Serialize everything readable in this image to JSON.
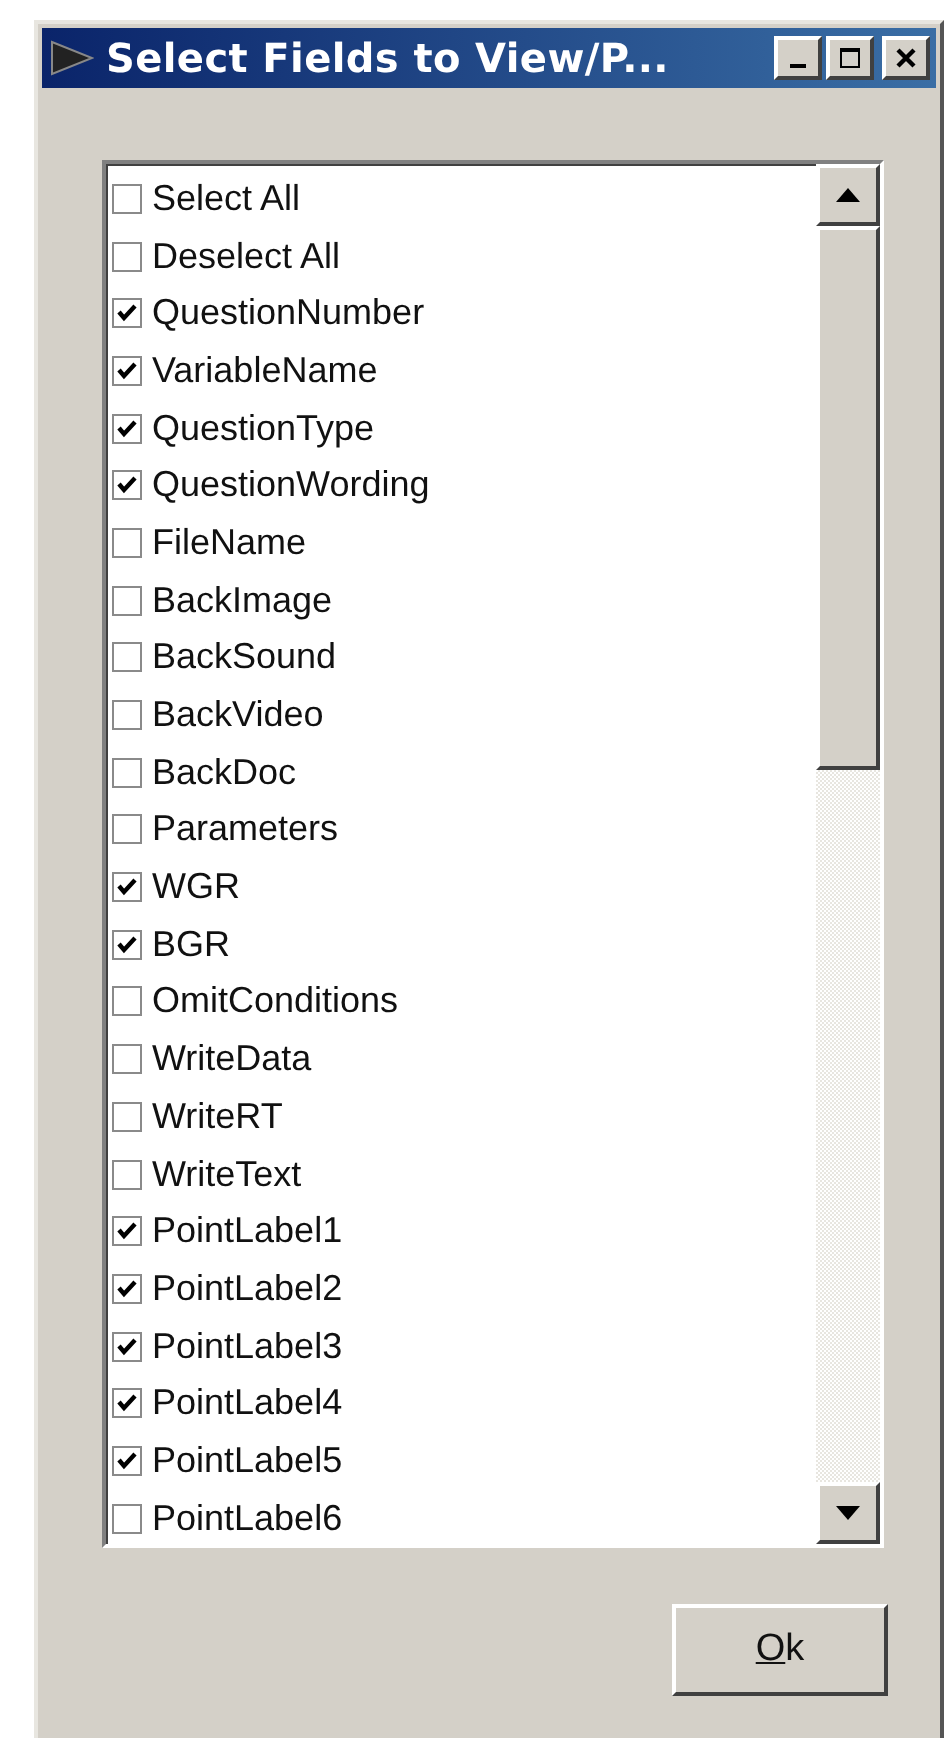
{
  "window": {
    "title": "Select Fields to View/P..."
  },
  "fields": [
    {
      "label": "Select All",
      "checked": false
    },
    {
      "label": "Deselect All",
      "checked": false
    },
    {
      "label": "QuestionNumber",
      "checked": true
    },
    {
      "label": "VariableName",
      "checked": true
    },
    {
      "label": "QuestionType",
      "checked": true
    },
    {
      "label": "QuestionWording",
      "checked": true
    },
    {
      "label": "FileName",
      "checked": false
    },
    {
      "label": "BackImage",
      "checked": false
    },
    {
      "label": "BackSound",
      "checked": false
    },
    {
      "label": "BackVideo",
      "checked": false
    },
    {
      "label": "BackDoc",
      "checked": false
    },
    {
      "label": "Parameters",
      "checked": false
    },
    {
      "label": "WGR",
      "checked": true
    },
    {
      "label": "BGR",
      "checked": true
    },
    {
      "label": "OmitConditions",
      "checked": false
    },
    {
      "label": "WriteData",
      "checked": false
    },
    {
      "label": "WriteRT",
      "checked": false
    },
    {
      "label": "WriteText",
      "checked": false
    },
    {
      "label": "PointLabel1",
      "checked": true
    },
    {
      "label": "PointLabel2",
      "checked": true
    },
    {
      "label": "PointLabel3",
      "checked": true
    },
    {
      "label": "PointLabel4",
      "checked": true
    },
    {
      "label": "PointLabel5",
      "checked": true
    },
    {
      "label": "PointLabel6",
      "checked": false
    }
  ],
  "ok_button": {
    "label": "Ok",
    "mnemonic_underlined": true
  }
}
